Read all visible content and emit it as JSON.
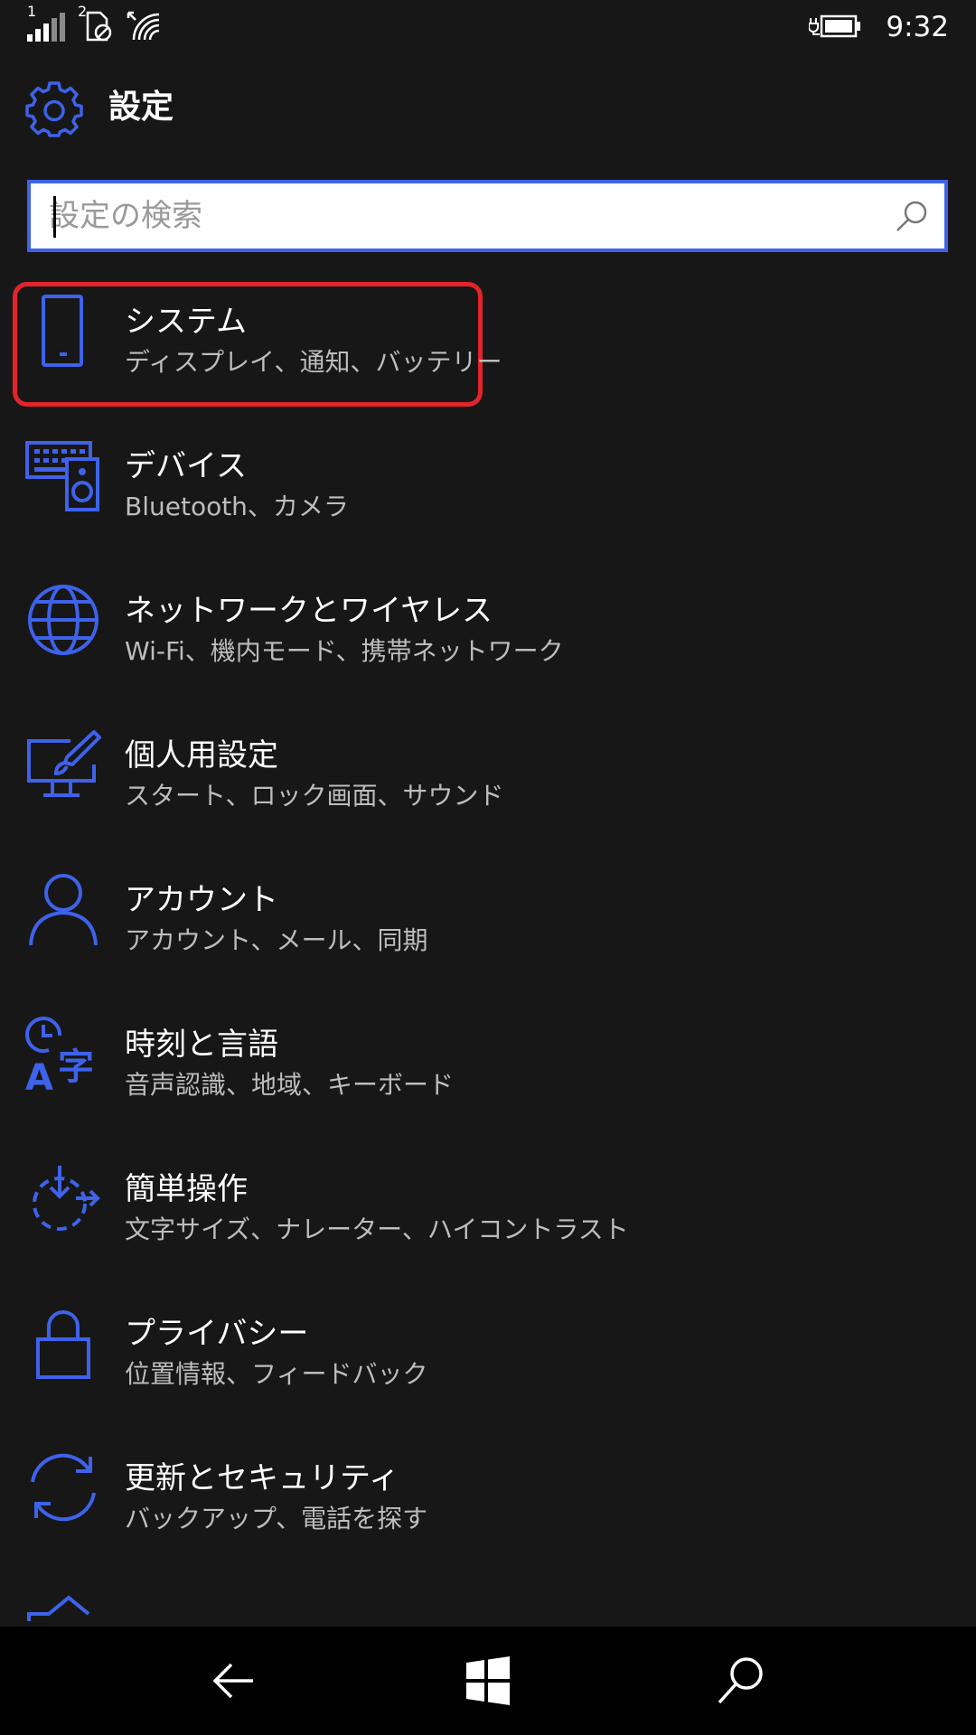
{
  "status_bar": {
    "sim1_label": "1",
    "sim2_label": "2",
    "time": "9:32"
  },
  "header": {
    "title": "設定",
    "icon": "gear-icon"
  },
  "search": {
    "placeholder": "設定の検索",
    "value": ""
  },
  "settings": [
    {
      "title": "システム",
      "subtitle": "ディスプレイ、通知、バッテリー",
      "icon": "phone-icon",
      "highlighted": true
    },
    {
      "title": "デバイス",
      "subtitle": "Bluetooth、カメラ",
      "icon": "devices-icon"
    },
    {
      "title": "ネットワークとワイヤレス",
      "subtitle": "Wi-Fi、機内モード、携帯ネットワーク",
      "icon": "globe-icon"
    },
    {
      "title": "個人用設定",
      "subtitle": "スタート、ロック画面、サウンド",
      "icon": "personalization-icon"
    },
    {
      "title": "アカウント",
      "subtitle": "アカウント、メール、同期",
      "icon": "person-icon"
    },
    {
      "title": "時刻と言語",
      "subtitle": "音声認識、地域、キーボード",
      "icon": "time-language-icon"
    },
    {
      "title": "簡単操作",
      "subtitle": "文字サイズ、ナレーター、ハイコントラスト",
      "icon": "ease-of-access-icon"
    },
    {
      "title": "プライバシー",
      "subtitle": "位置情報、フィードバック",
      "icon": "lock-icon"
    },
    {
      "title": "更新とセキュリティ",
      "subtitle": "バックアップ、電話を探す",
      "icon": "sync-icon"
    }
  ],
  "colors": {
    "accent": "#3e62ea",
    "background": "#171717",
    "highlight_border": "#e3242b",
    "subtitle": "#bdbdbd"
  }
}
